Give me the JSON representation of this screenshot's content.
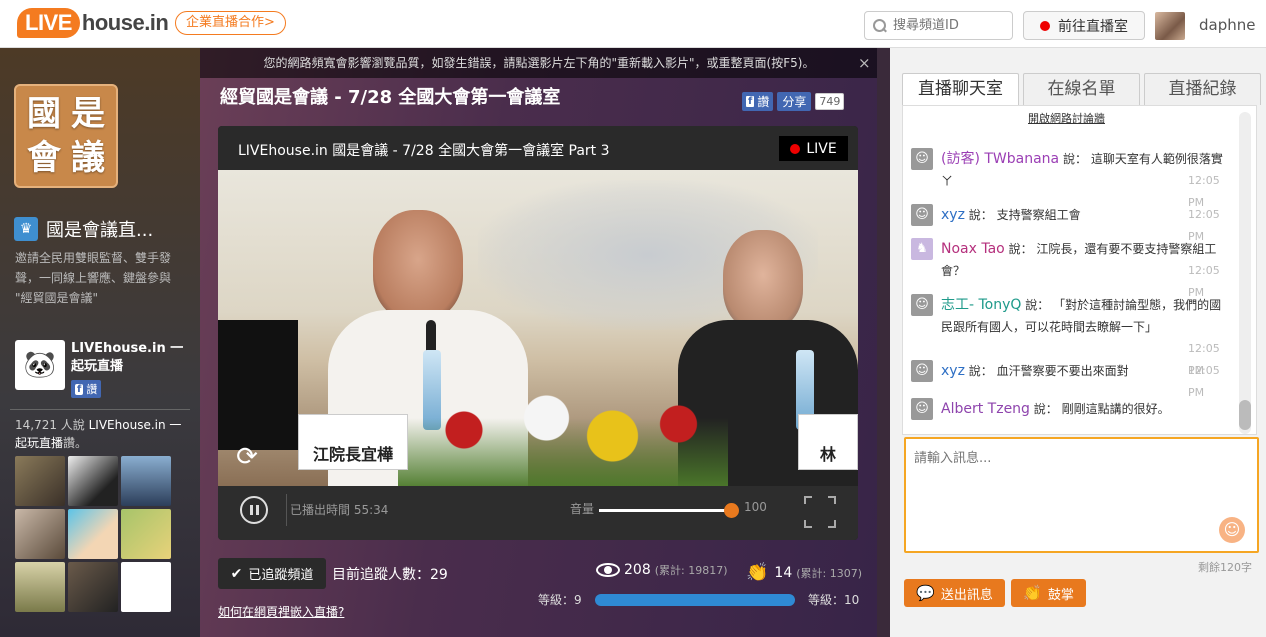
{
  "header": {
    "logo_live": "LIVE",
    "logo_house": "house.in",
    "biz_label": "企業直播合作>",
    "search_placeholder": "搜尋頻道ID",
    "goto_live_label": "前往直播室",
    "username": "daphne"
  },
  "sidebar": {
    "logo_chars": [
      "國",
      "是",
      "會",
      "議"
    ],
    "channel_title": "國是會議直...",
    "channel_desc": "邀請全民用雙眼監督、雙手發聲，一同線上響應、鍵盤參與 \"經貿國是會議\"",
    "fb_page_name": "LIVEhouse.in 一起玩直播",
    "fb_like_label": "讚",
    "fb_count_text_prefix": "14,721 人說 ",
    "fb_count_page": "LIVEhouse.in 一起玩直播",
    "fb_count_suffix": "讚。"
  },
  "center": {
    "notice": "您的網路頻寬會影響瀏覽品質，如發生錯誤，請點選影片左下角的\"重新載入影片\"，或重整頁面(按F5)。",
    "notice_close": "×",
    "title": "經貿國是會議 - 7/28 全國大會第一會議室",
    "fb_like_label": "讚",
    "share_label": "分享",
    "share_count": "749",
    "player": {
      "title": "LIVEhouse.in 國是會議 - 7/28 全國大會第一會議室 Part 3",
      "live_label": "LIVE",
      "nameplate_left": "江院長宜樺",
      "nameplate_right": "林",
      "elapsed": "已播出時間 55:34",
      "volume_label": "音量",
      "volume_value": "100",
      "volume_fraction": 1.0
    },
    "follow_label": "已追蹤頻道",
    "follow_count": "目前追蹤人數：29",
    "embed_link": "如何在網頁裡嵌入直播?",
    "views": "208",
    "views_total": "(累計: 19817)",
    "claps": "14",
    "claps_total": "(累計: 1307)",
    "level_left": "等級：9",
    "level_right": "等級：10",
    "level_fraction": 1.0
  },
  "chat": {
    "tabs": [
      "直播聊天室",
      "在線名單",
      "直播紀錄"
    ],
    "forum_link": "開啟網路討論牆",
    "says": "說：",
    "messages": [
      {
        "name": "(訪客) TWbanana",
        "text": "這聊天室有人範例很落實ㄚ",
        "time": "12:05 PM",
        "color": "#9b3fb5"
      },
      {
        "name": "xyz",
        "text": "支持警察組工會",
        "time": "12:05 PM",
        "color": "#2e6fc4"
      },
      {
        "name": "Noax Tao",
        "text": "江院長，還有要不要支持警察組工會？",
        "time": "12:05 PM",
        "color": "#b5307d"
      },
      {
        "name": "志工- TonyQ",
        "text": "「對於這種討論型態，我們的國民跟所有國人，可以花時間去瞭解一下」",
        "time": "12:05 PM",
        "color": "#1e9a8a"
      },
      {
        "name": "xyz",
        "text": "血汗警察要不要出來面對",
        "time": "12:05 PM",
        "color": "#2e6fc4"
      },
      {
        "name": "Albert Tzeng",
        "text": "剛剛這點講的很好。",
        "time": "12:05 PM",
        "color": "#8e44ad"
      }
    ],
    "input_placeholder": "請輸入訊息...",
    "remaining": "剩餘120字",
    "send_label": "送出訊息",
    "clap_label": "鼓掌"
  },
  "colors": {
    "brand_orange": "#f47b20",
    "button_orange": "#e8791e",
    "live_red": "#e00000",
    "fb_blue": "#4267b2"
  }
}
